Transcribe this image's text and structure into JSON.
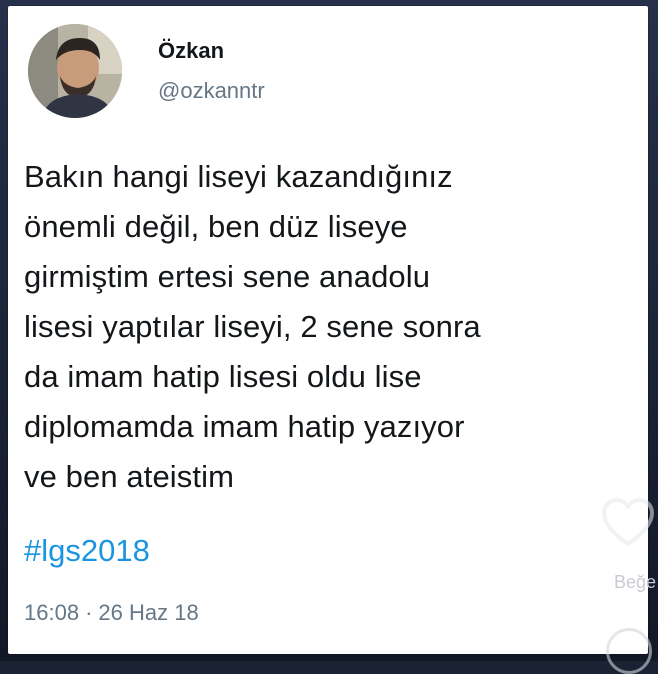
{
  "tweet": {
    "author_name": "Özkan",
    "author_handle": "@ozkanntr",
    "avatar_icon": "user-avatar-photo",
    "body_lines": [
      "Bakın hangi liseyi kazandığınız",
      "önemli değil, ben düz liseye",
      "girmiştim ertesi sene anadolu",
      "lisesi yaptılar liseyi, 2 sene sonra",
      "da imam hatip lisesi oldu lise",
      "diplomamda imam hatip yazıyor",
      "ve ben ateistim"
    ],
    "hashtag": "#lgs2018",
    "time": "16:08",
    "separator": "·",
    "date": "26 Haz 18"
  },
  "overlay": {
    "like_icon": "heart-outline-icon",
    "like_label": "Beğe"
  },
  "colors": {
    "text": "#14171a",
    "muted": "#657786",
    "hashtag": "#1b95e0",
    "background_frame": "#1b2233"
  }
}
